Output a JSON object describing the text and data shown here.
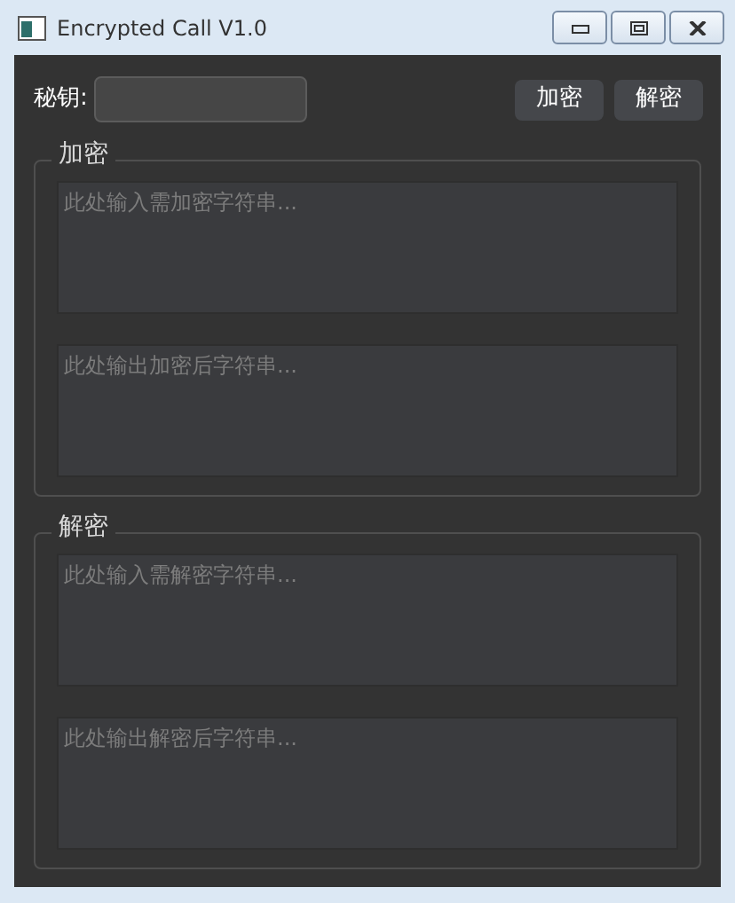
{
  "window": {
    "title": "Encrypted Call V1.0"
  },
  "key": {
    "label": "秘钥:"
  },
  "buttons": [
    "加密",
    "解密"
  ],
  "groups": [
    {
      "title": "加密",
      "fields": [
        {
          "placeholder": "此处输入需加密字符串..."
        },
        {
          "placeholder": "此处输出加密后字符串..."
        }
      ]
    },
    {
      "title": "解密",
      "fields": [
        {
          "placeholder": "此处输入需解密字符串..."
        },
        {
          "placeholder": "此处输出解密后字符串..."
        }
      ]
    }
  ]
}
